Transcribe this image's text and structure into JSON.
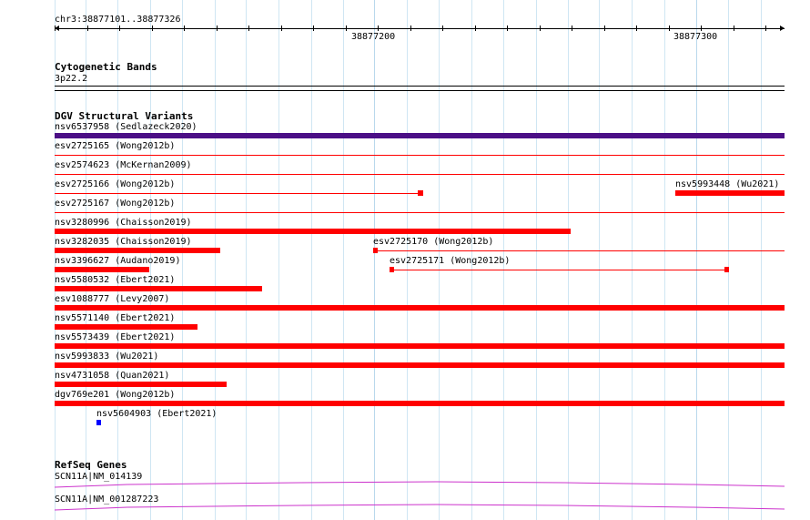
{
  "window": {
    "position_label": "chr3:38877101..38877326"
  },
  "ruler": {
    "labels": [
      "38877200",
      "38877300"
    ]
  },
  "cytobands": {
    "title": "Cytogenetic Bands",
    "band": "3p22.2"
  },
  "dgv": {
    "title": "DGV Structural Variants",
    "colors": {
      "dark": "#4b0f86",
      "red": "#ff0000",
      "blue": "#0000ff"
    },
    "rows": [
      [
        "nsv6537958 (Sedlazeck2020)"
      ],
      [
        "esv2725165 (Wong2012b)"
      ],
      [
        "esv2574623 (McKernan2009)"
      ],
      [
        "esv2725166 (Wong2012b)",
        "nsv5993448 (Wu2021)"
      ],
      [
        "esv2725167 (Wong2012b)"
      ],
      [
        "nsv3280996 (Chaisson2019)"
      ],
      [
        "nsv3282035 (Chaisson2019)",
        "esv2725170 (Wong2012b)"
      ],
      [
        "nsv3396627 (Audano2019)",
        "esv2725171 (Wong2012b)"
      ],
      [
        "nsv5580532 (Ebert2021)"
      ],
      [
        "esv1088777 (Levy2007)"
      ],
      [
        "nsv5571140 (Ebert2021)"
      ],
      [
        "nsv5573439 (Ebert2021)"
      ],
      [
        "nsv5993833 (Wu2021)"
      ],
      [
        "nsv4731058 (Quan2021)"
      ],
      [
        "dgv769e201 (Wong2012b)"
      ],
      [
        "nsv5604903 (Ebert2021)"
      ]
    ]
  },
  "refseq": {
    "title": "RefSeq Genes",
    "color": "#cc33cc",
    "genes": [
      "SCN11A|NM_014139",
      "SCN11A|NM_001287223"
    ]
  }
}
